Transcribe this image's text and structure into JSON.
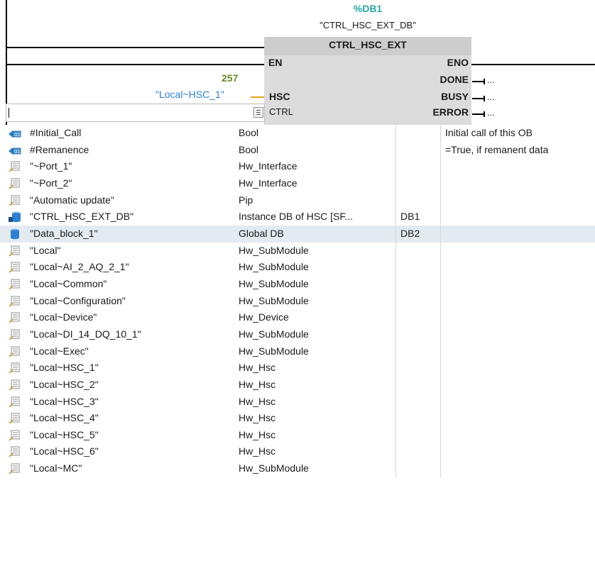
{
  "block": {
    "db_number": "%DB1",
    "db_name": "\"CTRL_HSC_EXT_DB\"",
    "title": "CTRL_HSC_EXT",
    "pins_in": {
      "en": "EN",
      "hsc": "HSC",
      "ctrl": "CTRL"
    },
    "pins_out": {
      "eno": "ENO",
      "done": "DONE",
      "busy": "BUSY",
      "error": "ERROR"
    },
    "out_placeholder": "...",
    "hsc_value": "257",
    "hsc_tag": "\"Local~HSC_1\"",
    "ctrl_input_value": ""
  },
  "colors": {
    "db_number": "#2aa7a2",
    "constant": "#6a8a25",
    "tag": "#2a7fc9",
    "wire_pending": "#e8a317",
    "selected_row": "#e3ebf1"
  },
  "tag_list": [
    {
      "icon": "local-tag-icon",
      "name": "#Initial_Call",
      "type": "Bool",
      "db": "",
      "comment": "Initial call of this OB"
    },
    {
      "icon": "local-tag-icon",
      "name": "#Remanence",
      "type": "Bool",
      "db": "",
      "comment": "=True, if remanent data"
    },
    {
      "icon": "hw-constant-icon",
      "name": "\"~Port_1\"",
      "type": "Hw_Interface",
      "db": "",
      "comment": ""
    },
    {
      "icon": "hw-constant-icon",
      "name": "\"~Port_2\"",
      "type": "Hw_Interface",
      "db": "",
      "comment": ""
    },
    {
      "icon": "hw-constant-icon",
      "name": "\"Automatic update\"",
      "type": "Pip",
      "db": "",
      "comment": ""
    },
    {
      "icon": "instance-db-icon",
      "name": "\"CTRL_HSC_EXT_DB\"",
      "type": "Instance DB of HSC [SF...",
      "db": "DB1",
      "comment": ""
    },
    {
      "icon": "global-db-icon",
      "name": "\"Data_block_1\"",
      "type": "Global DB",
      "db": "DB2",
      "comment": "",
      "selected": true
    },
    {
      "icon": "hw-constant-icon",
      "name": "\"Local\"",
      "type": "Hw_SubModule",
      "db": "",
      "comment": ""
    },
    {
      "icon": "hw-constant-icon",
      "name": "\"Local~AI_2_AQ_2_1\"",
      "type": "Hw_SubModule",
      "db": "",
      "comment": ""
    },
    {
      "icon": "hw-constant-icon",
      "name": "\"Local~Common\"",
      "type": "Hw_SubModule",
      "db": "",
      "comment": ""
    },
    {
      "icon": "hw-constant-icon",
      "name": "\"Local~Configuration\"",
      "type": "Hw_SubModule",
      "db": "",
      "comment": ""
    },
    {
      "icon": "hw-constant-icon",
      "name": "\"Local~Device\"",
      "type": "Hw_Device",
      "db": "",
      "comment": ""
    },
    {
      "icon": "hw-constant-icon",
      "name": "\"Local~DI_14_DQ_10_1\"",
      "type": "Hw_SubModule",
      "db": "",
      "comment": ""
    },
    {
      "icon": "hw-constant-icon",
      "name": "\"Local~Exec\"",
      "type": "Hw_SubModule",
      "db": "",
      "comment": ""
    },
    {
      "icon": "hw-constant-icon",
      "name": "\"Local~HSC_1\"",
      "type": "Hw_Hsc",
      "db": "",
      "comment": ""
    },
    {
      "icon": "hw-constant-icon",
      "name": "\"Local~HSC_2\"",
      "type": "Hw_Hsc",
      "db": "",
      "comment": ""
    },
    {
      "icon": "hw-constant-icon",
      "name": "\"Local~HSC_3\"",
      "type": "Hw_Hsc",
      "db": "",
      "comment": ""
    },
    {
      "icon": "hw-constant-icon",
      "name": "\"Local~HSC_4\"",
      "type": "Hw_Hsc",
      "db": "",
      "comment": ""
    },
    {
      "icon": "hw-constant-icon",
      "name": "\"Local~HSC_5\"",
      "type": "Hw_Hsc",
      "db": "",
      "comment": ""
    },
    {
      "icon": "hw-constant-icon",
      "name": "\"Local~HSC_6\"",
      "type": "Hw_Hsc",
      "db": "",
      "comment": ""
    },
    {
      "icon": "hw-constant-icon",
      "name": "\"Local~MC\"",
      "type": "Hw_SubModule",
      "db": "",
      "comment": ""
    }
  ]
}
